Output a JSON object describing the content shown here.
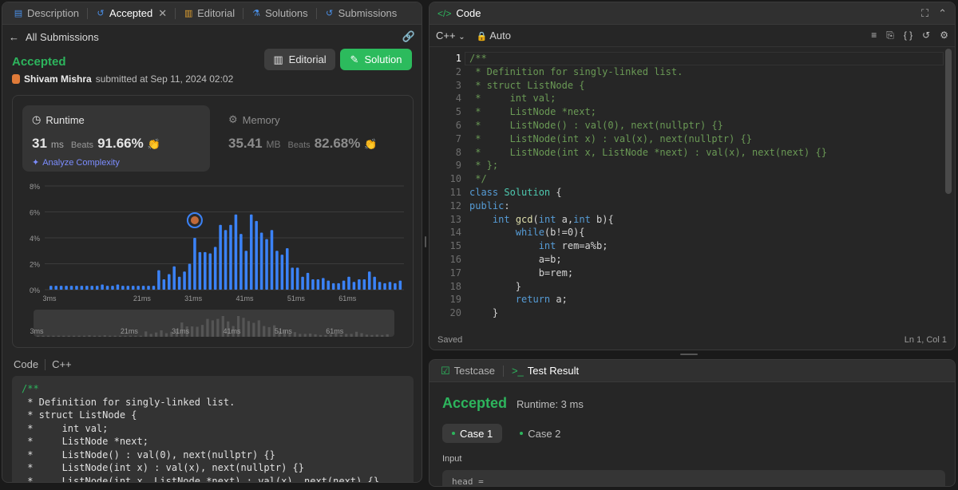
{
  "left_tabs": [
    {
      "label": "Description",
      "icon": "description-icon"
    },
    {
      "label": "Accepted",
      "icon": "history-icon"
    },
    {
      "label": "Editorial",
      "icon": "book-icon"
    },
    {
      "label": "Solutions",
      "icon": "flask-icon"
    },
    {
      "label": "Submissions",
      "icon": "history-icon"
    }
  ],
  "all_submissions": "All Submissions",
  "status": "Accepted",
  "submitter": "Shivam Mishra",
  "submitted_at": "submitted at Sep 11, 2024 02:02",
  "editorial_btn": "Editorial",
  "solution_btn": "Solution",
  "runtime": {
    "label": "Runtime",
    "value": "31",
    "unit": "ms",
    "beats_label": "Beats",
    "beats": "91.66%",
    "analyze": "Analyze Complexity"
  },
  "memory": {
    "label": "Memory",
    "value": "35.41",
    "unit": "MB",
    "beats_label": "Beats",
    "beats": "82.68%"
  },
  "chart_data": {
    "type": "bar",
    "ylabels": [
      "8%",
      "6%",
      "4%",
      "2%",
      "0%"
    ],
    "ylim": [
      0,
      8
    ],
    "xlabels": [
      "3ms",
      "21ms",
      "31ms",
      "41ms",
      "51ms",
      "61ms"
    ],
    "x_start_ms": 3,
    "x_step_ms": 1,
    "values": [
      0.3,
      0.3,
      0.3,
      0.3,
      0.3,
      0.3,
      0.3,
      0.3,
      0.3,
      0.3,
      0.4,
      0.3,
      0.3,
      0.4,
      0.3,
      0.3,
      0.3,
      0.3,
      0.3,
      0.3,
      0.3,
      1.5,
      0.8,
      1.2,
      1.8,
      1.0,
      1.4,
      2.0,
      4.0,
      2.9,
      2.9,
      2.8,
      3.3,
      5.0,
      4.6,
      5.0,
      5.8,
      4.3,
      3.0,
      5.8,
      5.3,
      4.4,
      3.9,
      4.6,
      3.0,
      2.7,
      3.2,
      1.7,
      1.7,
      1.0,
      1.3,
      0.8,
      0.8,
      0.9,
      0.7,
      0.5,
      0.5,
      0.7,
      1.0,
      0.6,
      0.8,
      0.8,
      1.4,
      1.0,
      0.6,
      0.5,
      0.6,
      0.5,
      0.7
    ],
    "highlight_ms": 31,
    "grid": true,
    "bar_color": "#3b82f6",
    "minimap_xlabels": [
      "3ms",
      "21ms",
      "31ms",
      "41ms",
      "51ms",
      "61ms"
    ]
  },
  "code_section": {
    "label": "Code",
    "lang": "C++"
  },
  "left_code_lines": [
    "/**",
    " * Definition for singly-linked list.",
    " * struct ListNode {",
    " *     int val;",
    " *     ListNode *next;",
    " *     ListNode() : val(0), next(nullptr) {}",
    " *     ListNode(int x) : val(x), next(nullptr) {}",
    " *     ListNode(int x, ListNode *next) : val(x), next(next) {}"
  ],
  "code_panel": {
    "title": "Code",
    "language": "C++",
    "mode": "Auto",
    "status_left": "Saved",
    "status_right": "Ln 1, Col 1"
  },
  "editor_line_numbers": [
    "1",
    "2",
    "3",
    "4",
    "5",
    "6",
    "7",
    "8",
    "9",
    "10",
    "11",
    "12",
    "13",
    "14",
    "15",
    "16",
    "17",
    "18",
    "19",
    "20"
  ],
  "test_panel": {
    "tab_testcase": "Testcase",
    "tab_result": "Test Result",
    "status": "Accepted",
    "runtime": "Runtime: 3 ms",
    "cases": [
      "Case 1",
      "Case 2"
    ],
    "input_label": "Input",
    "input_value": "head ="
  },
  "colors": {
    "accent_green": "#2db55d",
    "bar_blue": "#3b82f6",
    "analyze_purple": "#7c8dff"
  }
}
